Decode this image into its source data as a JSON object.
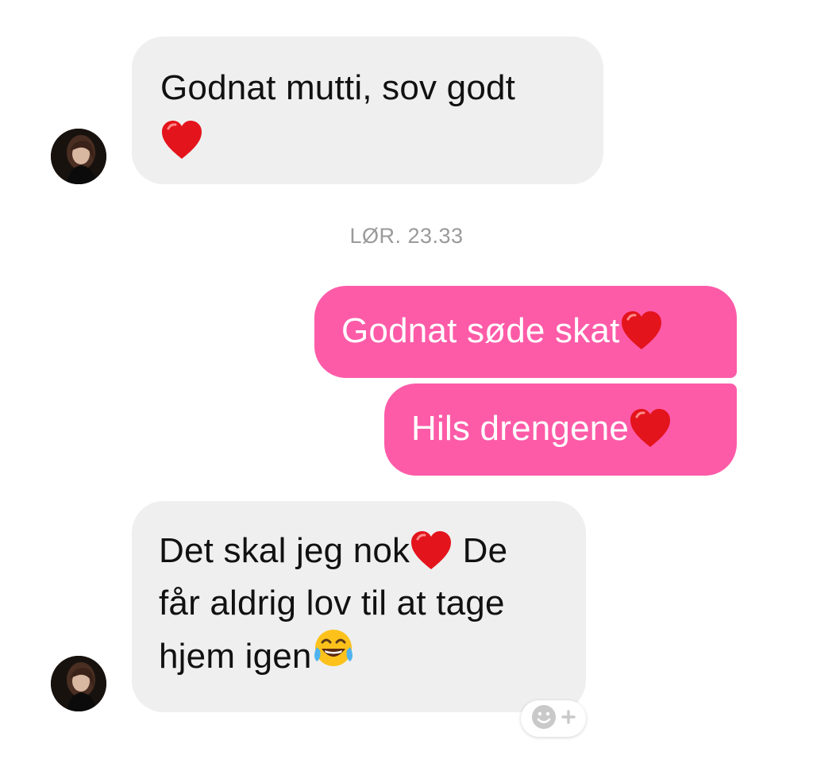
{
  "conversation": {
    "messages": [
      {
        "direction": "incoming",
        "lines": [
          "Godnat mutti, sov godt",
          ""
        ],
        "emoji": [
          "red-heart"
        ]
      },
      {
        "direction": "outgoing",
        "text": "Godnat søde skat",
        "emoji": [
          "red-heart"
        ]
      },
      {
        "direction": "outgoing",
        "text": "Hils drengene",
        "emoji": [
          "red-heart"
        ]
      },
      {
        "direction": "incoming",
        "line1_before": "Det skal jeg nok",
        "line1_after": " De",
        "line2": "får aldrig lov til at tage",
        "line3": "hjem igen",
        "emoji": [
          "red-heart",
          "face-with-tears-of-joy"
        ]
      }
    ],
    "timestamp": "LØR. 23.33",
    "reaction_button_icons": [
      "smiley-face-icon",
      "plus-icon"
    ]
  },
  "colors": {
    "incoming_bubble": "#efefef",
    "outgoing_bubble": "#fd5ba8",
    "incoming_text": "#111111",
    "outgoing_text": "#ffffff",
    "timestamp_text": "#9a9a9a"
  }
}
